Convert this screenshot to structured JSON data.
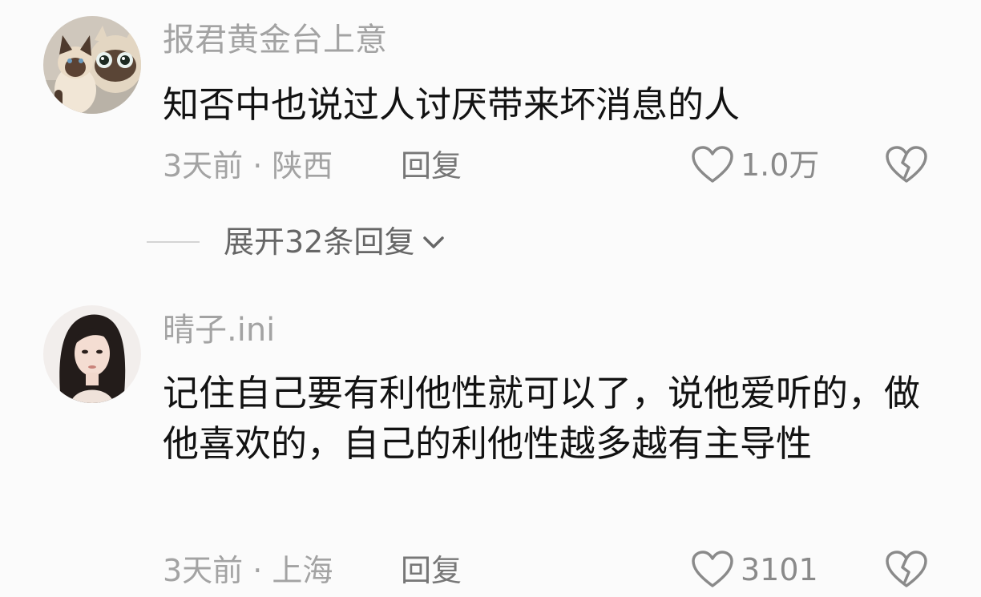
{
  "comments": [
    {
      "username": "报君黄金台上意",
      "avatar": "cat-plush-avatar",
      "content": "知否中也说过人讨厌带来坏消息的人",
      "time_location": "3天前 · 陕西",
      "reply_label": "回复",
      "likes": "1.0万"
    },
    {
      "username": "晴子.ini",
      "avatar": "woman-portrait-avatar",
      "content": "记住自己要有利他性就可以了，说他爱听的，做他喜欢的，自己的利他性越多越有主导性",
      "time_location": "3天前 · 上海",
      "reply_label": "回复",
      "likes": "3101"
    }
  ],
  "expand_replies": {
    "label": "展开32条回复",
    "icon": "chevron-down-icon"
  },
  "colors": {
    "background": "#fbfbfb",
    "username": "#a3a3a3",
    "content": "#121212",
    "meta": "#a3a3a3"
  }
}
